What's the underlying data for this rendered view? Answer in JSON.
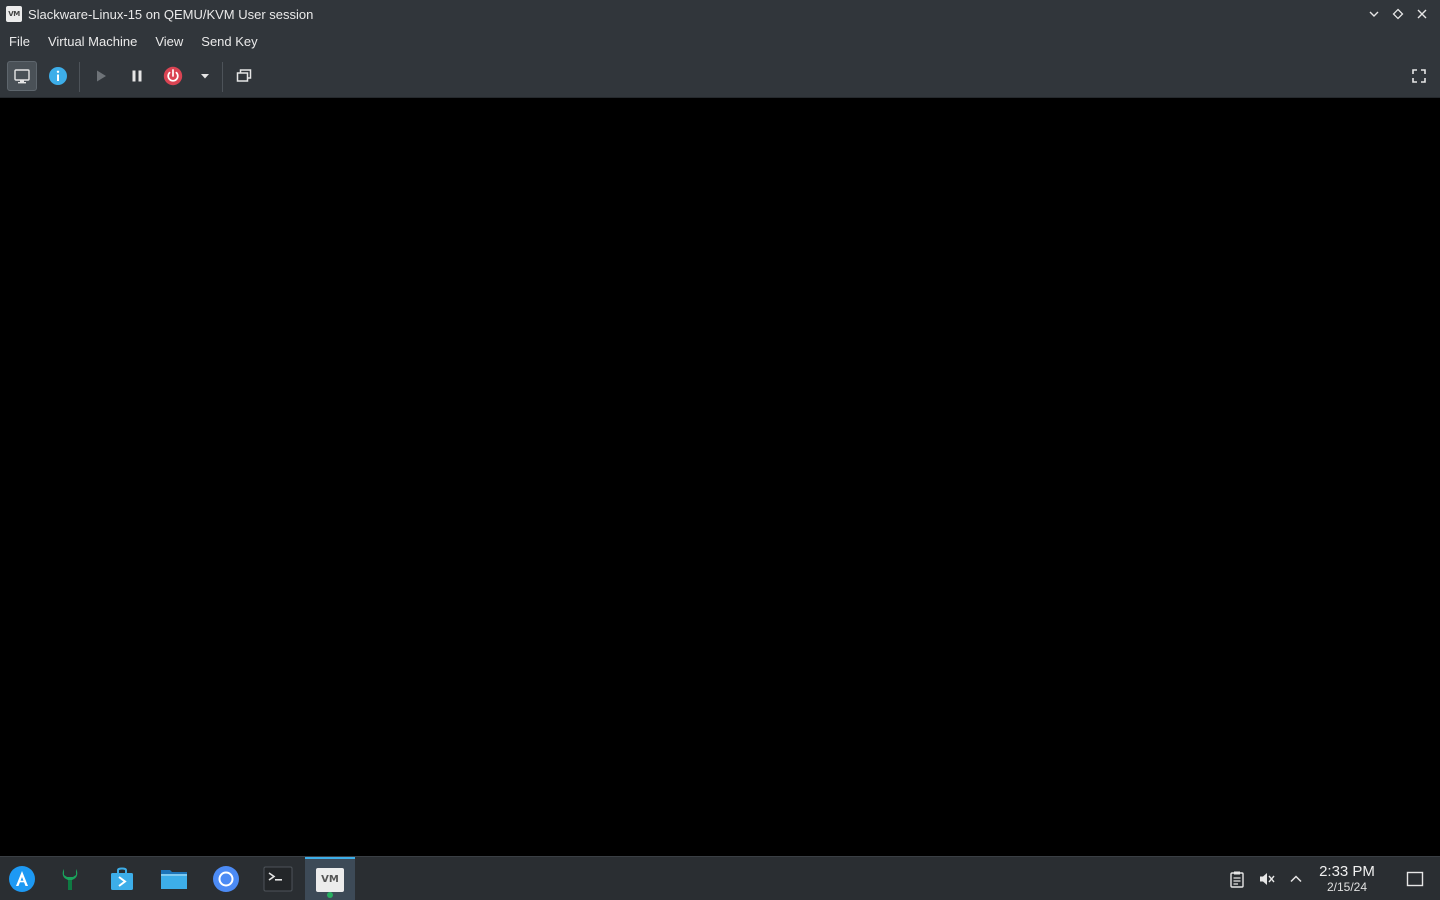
{
  "window": {
    "title": "Slackware-Linux-15 on QEMU/KVM User session",
    "app_icon_text": "VM"
  },
  "menu": {
    "items": [
      {
        "label": "File"
      },
      {
        "label": "Virtual Machine"
      },
      {
        "label": "View"
      },
      {
        "label": "Send Key"
      }
    ]
  },
  "toolbar": {
    "icons": [
      "console-icon",
      "info-icon",
      "run-icon",
      "pause-icon",
      "power-icon",
      "dropdown-icon",
      "snapshots-icon",
      "fullscreen-icon"
    ],
    "power_color": "#da4453",
    "info_color": "#3daee9"
  },
  "taskbar": {
    "launchers": [
      "app-launcher-icon",
      "system-settings-icon",
      "discover-icon",
      "file-manager-icon",
      "chromium-icon",
      "terminal-icon",
      "virt-manager-icon"
    ],
    "active_app_text": "VM",
    "clock_time": "2:33 PM",
    "clock_date": "2/15/24",
    "accent": "#3daee9"
  }
}
